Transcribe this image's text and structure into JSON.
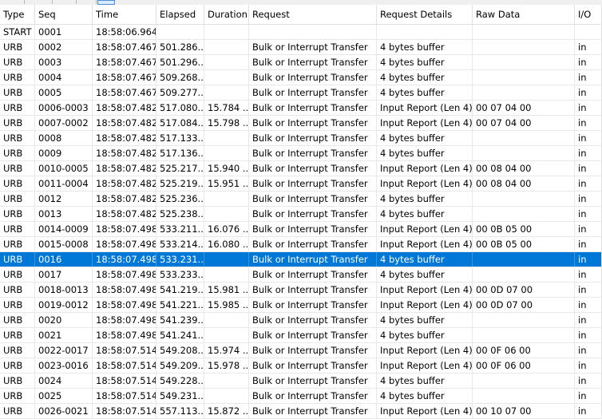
{
  "columns": [
    "Type",
    "Seq",
    "Time",
    "Elapsed",
    "Duration",
    "Request",
    "Request Details",
    "Raw Data",
    "I/O"
  ],
  "selected_index": 15,
  "rows": [
    [
      "START",
      "0001",
      "18:58:06.964",
      "",
      "",
      "",
      "",
      "",
      ""
    ],
    [
      "URB",
      "0002",
      "18:58:07.467",
      "501.286...",
      "",
      "Bulk or Interrupt Transfer",
      "4 bytes buffer",
      "",
      "in"
    ],
    [
      "URB",
      "0003",
      "18:58:07.467",
      "501.296...",
      "",
      "Bulk or Interrupt Transfer",
      "4 bytes buffer",
      "",
      "in"
    ],
    [
      "URB",
      "0004",
      "18:58:07.467",
      "509.268...",
      "",
      "Bulk or Interrupt Transfer",
      "4 bytes buffer",
      "",
      "in"
    ],
    [
      "URB",
      "0005",
      "18:58:07.467",
      "509.277...",
      "",
      "Bulk or Interrupt Transfer",
      "4 bytes buffer",
      "",
      "in"
    ],
    [
      "URB",
      "0006-0003",
      "18:58:07.482",
      "517.080...",
      "15.784 ...",
      "Bulk or Interrupt Transfer",
      "Input Report (Len 4)",
      "00 07 04 00",
      "in"
    ],
    [
      "URB",
      "0007-0002",
      "18:58:07.482",
      "517.084...",
      "15.798 ...",
      "Bulk or Interrupt Transfer",
      "Input Report (Len 4)",
      "00 07 04 00",
      "in"
    ],
    [
      "URB",
      "0008",
      "18:58:07.482",
      "517.133...",
      "",
      "Bulk or Interrupt Transfer",
      "4 bytes buffer",
      "",
      "in"
    ],
    [
      "URB",
      "0009",
      "18:58:07.482",
      "517.136...",
      "",
      "Bulk or Interrupt Transfer",
      "4 bytes buffer",
      "",
      "in"
    ],
    [
      "URB",
      "0010-0005",
      "18:58:07.482",
      "525.217...",
      "15.940 ...",
      "Bulk or Interrupt Transfer",
      "Input Report (Len 4)",
      "00 08 04 00",
      "in"
    ],
    [
      "URB",
      "0011-0004",
      "18:58:07.482",
      "525.219...",
      "15.951 ...",
      "Bulk or Interrupt Transfer",
      "Input Report (Len 4)",
      "00 08 04 00",
      "in"
    ],
    [
      "URB",
      "0012",
      "18:58:07.482",
      "525.236...",
      "",
      "Bulk or Interrupt Transfer",
      "4 bytes buffer",
      "",
      "in"
    ],
    [
      "URB",
      "0013",
      "18:58:07.482",
      "525.238...",
      "",
      "Bulk or Interrupt Transfer",
      "4 bytes buffer",
      "",
      "in"
    ],
    [
      "URB",
      "0014-0009",
      "18:58:07.498",
      "533.211...",
      "16.076 ...",
      "Bulk or Interrupt Transfer",
      "Input Report (Len 4)",
      "00 0B 05 00",
      "in"
    ],
    [
      "URB",
      "0015-0008",
      "18:58:07.498",
      "533.214...",
      "16.080 ...",
      "Bulk or Interrupt Transfer",
      "Input Report (Len 4)",
      "00 0B 05 00",
      "in"
    ],
    [
      "URB",
      "0016",
      "18:58:07.498",
      "533.231...",
      "",
      "Bulk or Interrupt Transfer",
      "4 bytes buffer",
      "",
      "in"
    ],
    [
      "URB",
      "0017",
      "18:58:07.498",
      "533.233...",
      "",
      "Bulk or Interrupt Transfer",
      "4 bytes buffer",
      "",
      "in"
    ],
    [
      "URB",
      "0018-0013",
      "18:58:07.498",
      "541.219...",
      "15.981 ...",
      "Bulk or Interrupt Transfer",
      "Input Report (Len 4)",
      "00 0D 07 00",
      "in"
    ],
    [
      "URB",
      "0019-0012",
      "18:58:07.498",
      "541.221...",
      "15.985 ...",
      "Bulk or Interrupt Transfer",
      "Input Report (Len 4)",
      "00 0D 07 00",
      "in"
    ],
    [
      "URB",
      "0020",
      "18:58:07.498",
      "541.239...",
      "",
      "Bulk or Interrupt Transfer",
      "4 bytes buffer",
      "",
      "in"
    ],
    [
      "URB",
      "0021",
      "18:58:07.498",
      "541.241...",
      "",
      "Bulk or Interrupt Transfer",
      "4 bytes buffer",
      "",
      "in"
    ],
    [
      "URB",
      "0022-0017",
      "18:58:07.514",
      "549.208...",
      "15.974 ...",
      "Bulk or Interrupt Transfer",
      "Input Report (Len 4)",
      "00 0F 06 00",
      "in"
    ],
    [
      "URB",
      "0023-0016",
      "18:58:07.514",
      "549.209...",
      "15.978 ...",
      "Bulk or Interrupt Transfer",
      "Input Report (Len 4)",
      "00 0F 06 00",
      "in"
    ],
    [
      "URB",
      "0024",
      "18:58:07.514",
      "549.228...",
      "",
      "Bulk or Interrupt Transfer",
      "4 bytes buffer",
      "",
      "in"
    ],
    [
      "URB",
      "0025",
      "18:58:07.514",
      "549.231...",
      "",
      "Bulk or Interrupt Transfer",
      "4 bytes buffer",
      "",
      "in"
    ],
    [
      "URB",
      "0026-0021",
      "18:58:07.514",
      "557.113...",
      "15.872 ...",
      "Bulk or Interrupt Transfer",
      "Input Report (Len 4)",
      "00 10 07 00",
      "in"
    ]
  ]
}
